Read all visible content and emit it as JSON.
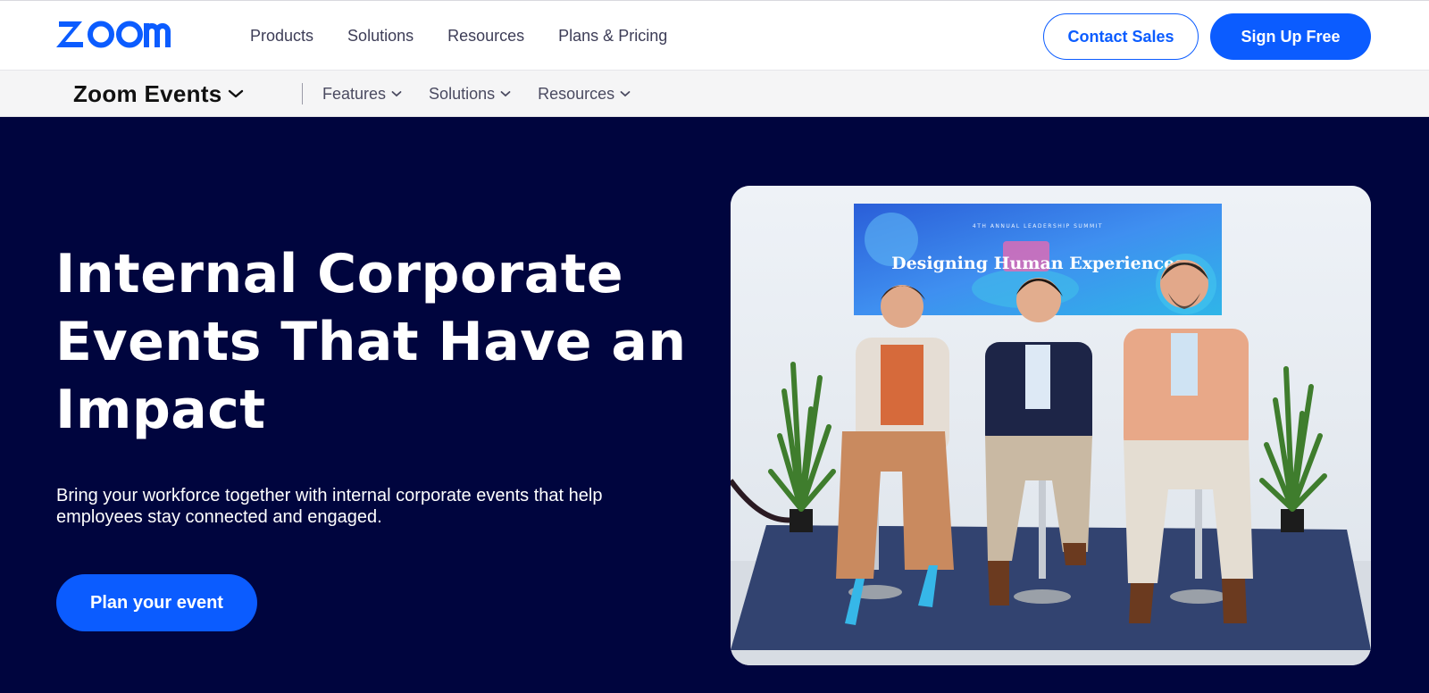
{
  "header": {
    "logo_text": "zoom",
    "nav_links": [
      "Products",
      "Solutions",
      "Resources",
      "Plans & Pricing"
    ],
    "contact_label": "Contact Sales",
    "signup_label": "Sign Up Free"
  },
  "subnav": {
    "product_name": "Zoom Events",
    "items": [
      "Features",
      "Solutions",
      "Resources"
    ]
  },
  "hero": {
    "title": "Internal Corporate Events That Have an Impact",
    "description": "Bring your workforce together with internal corporate events that help employees stay connected and engaged.",
    "cta_label": "Plan your event",
    "image": {
      "banner_headline": "Designing Human Experiences",
      "banner_subtitle": "4TH ANNUAL LEADERSHIP SUMMIT"
    }
  },
  "colors": {
    "brand_blue": "#0b5cff",
    "hero_background": "#00053e"
  }
}
